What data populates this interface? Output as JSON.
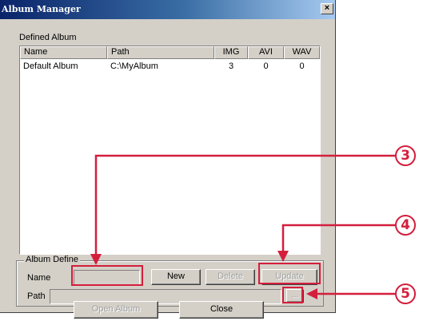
{
  "window": {
    "title": "Album Manager",
    "close_glyph": "×"
  },
  "defined_album": {
    "label": "Defined Album",
    "columns": [
      "Name",
      "Path",
      "IMG",
      "AVI",
      "WAV"
    ],
    "rows": [
      {
        "name": "Default Album",
        "path": "C:\\MyAlbum",
        "img": "3",
        "avi": "0",
        "wav": "0"
      }
    ]
  },
  "album_define": {
    "legend": "Album Define",
    "name_label": "Name",
    "name_value": "",
    "path_label": "Path",
    "path_value": "",
    "new_label": "New",
    "delete_label": "Delete",
    "update_label": "Update",
    "browse_label": "..."
  },
  "footer": {
    "open_label": "Open Album",
    "close_label": "Close"
  },
  "callouts": [
    "3",
    "4",
    "5"
  ],
  "colors": {
    "callout": "#d41e3c",
    "face": "#d4d0c8",
    "title_start": "#0a246a"
  }
}
